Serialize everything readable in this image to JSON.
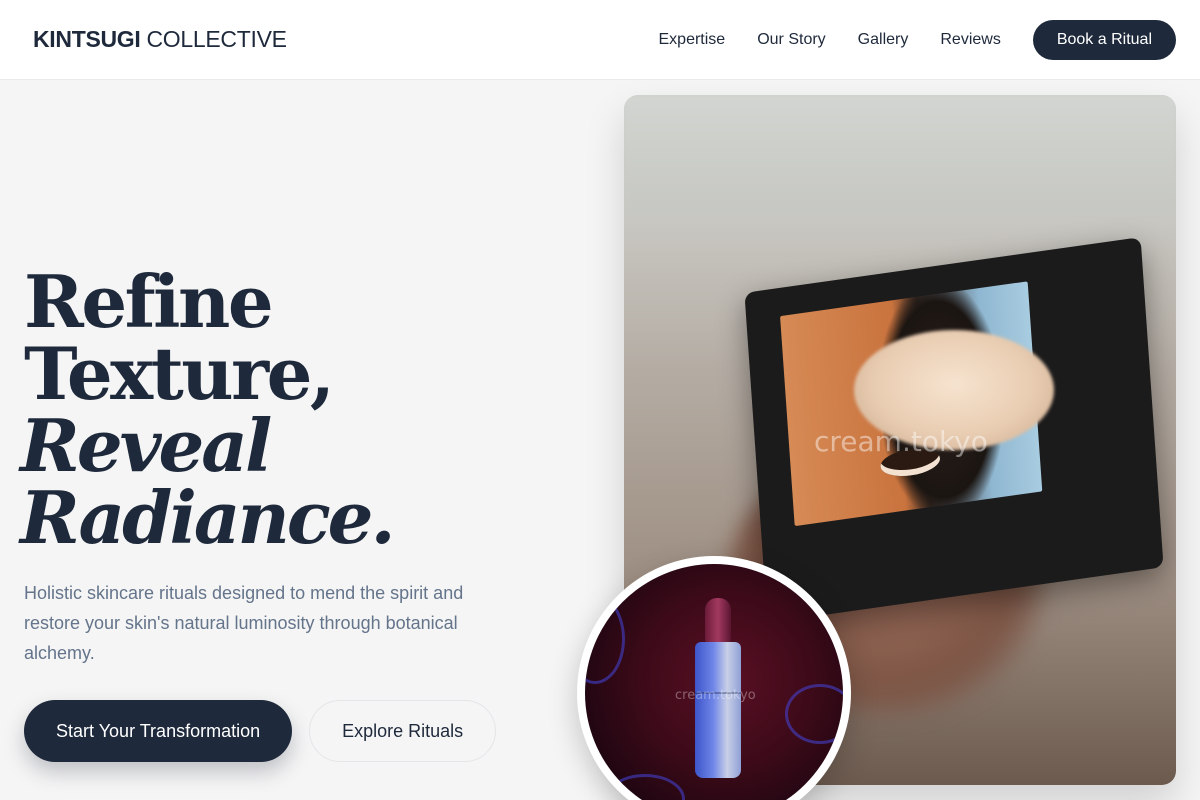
{
  "header": {
    "logo_strong": "KINTSUGI",
    "logo_light": "COLLECTIVE",
    "nav": [
      "Expertise",
      "Our Story",
      "Gallery",
      "Reviews"
    ],
    "cta": "Book a Ritual"
  },
  "hero": {
    "title_line1": "Refine Texture,",
    "title_line2": "Reveal Radiance.",
    "subtitle": "Holistic skincare rituals designed to mend the spirit and restore your skin's natural luminosity through botanical alchemy.",
    "primary_cta": "Start Your Transformation",
    "secondary_cta": "Explore Rituals"
  },
  "media": {
    "main_watermark": "cream.tokyo",
    "inset_watermark": "cream.tokyo"
  },
  "colors": {
    "brand_dark": "#1e293b",
    "muted_text": "#64748b",
    "page_bg": "#f5f5f5"
  }
}
